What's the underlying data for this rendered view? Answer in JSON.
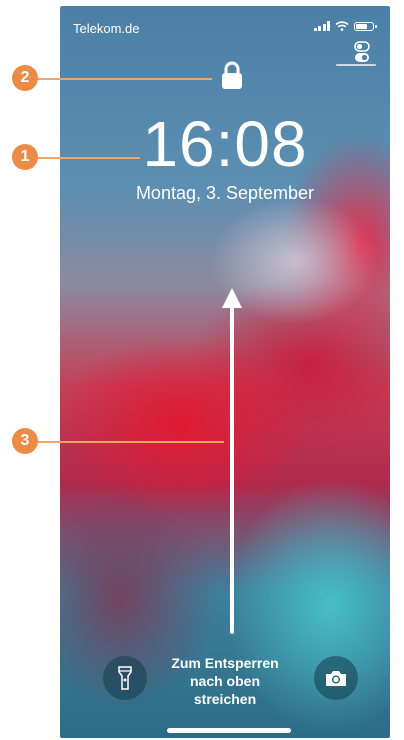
{
  "status_bar": {
    "carrier": "Telekom.de",
    "icons": [
      "cellular-signal-icon",
      "wifi-icon",
      "battery-icon"
    ]
  },
  "lock_screen": {
    "time": "16:08",
    "date": "Montag, 3. September",
    "lock_icon": "padlock-icon",
    "control_center_icon": "control-center-toggle-icon",
    "unlock_hint_lines": [
      "Zum Entsperren",
      "nach oben",
      "streichen"
    ],
    "flashlight_icon": "flashlight-icon",
    "camera_icon": "camera-icon"
  },
  "callouts": [
    {
      "number": "1",
      "target": "time"
    },
    {
      "number": "2",
      "target": "lock-icon"
    },
    {
      "number": "3",
      "target": "swipe-arrow"
    }
  ],
  "colors": {
    "callout": "#ec8b45",
    "callout_line": "#f0a468",
    "text": "#ffffff"
  }
}
